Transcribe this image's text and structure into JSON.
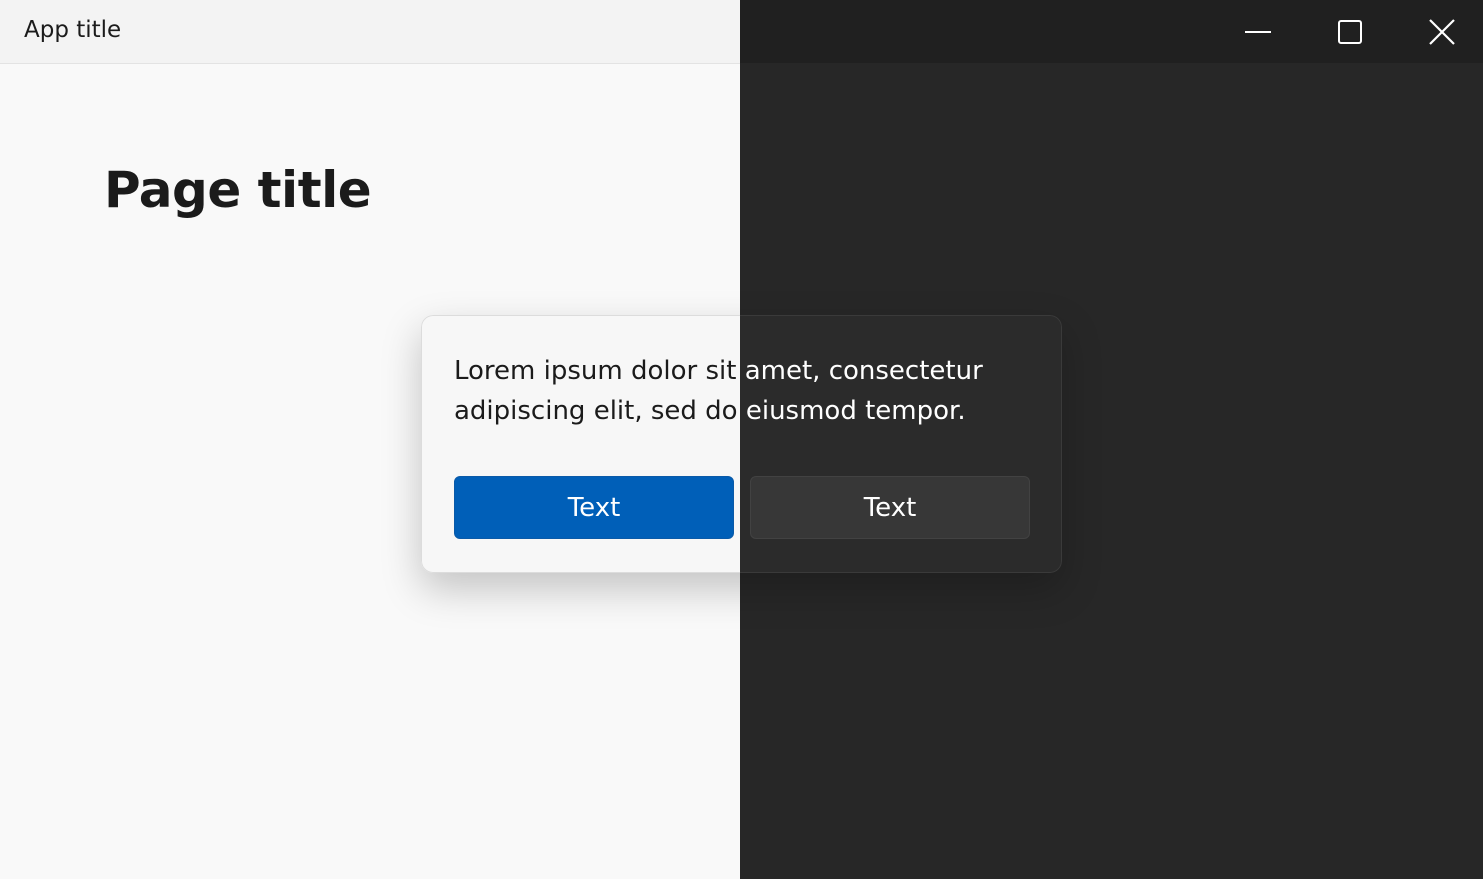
{
  "window": {
    "app_title": "App title",
    "controls": {
      "minimize_icon": "minimize-icon",
      "maximize_icon": "maximize-icon",
      "close_icon": "close-icon"
    }
  },
  "page": {
    "title": "Page title"
  },
  "dialog": {
    "message": "Lorem ipsum dolor sit amet, consectetur adipiscing elit, sed do eiusmod tempor.",
    "primary_button_label": "Text",
    "secondary_button_label": "Text"
  },
  "colors": {
    "light_background": "#f9f9f9",
    "dark_background": "#272727",
    "accent": "#005fb8"
  }
}
